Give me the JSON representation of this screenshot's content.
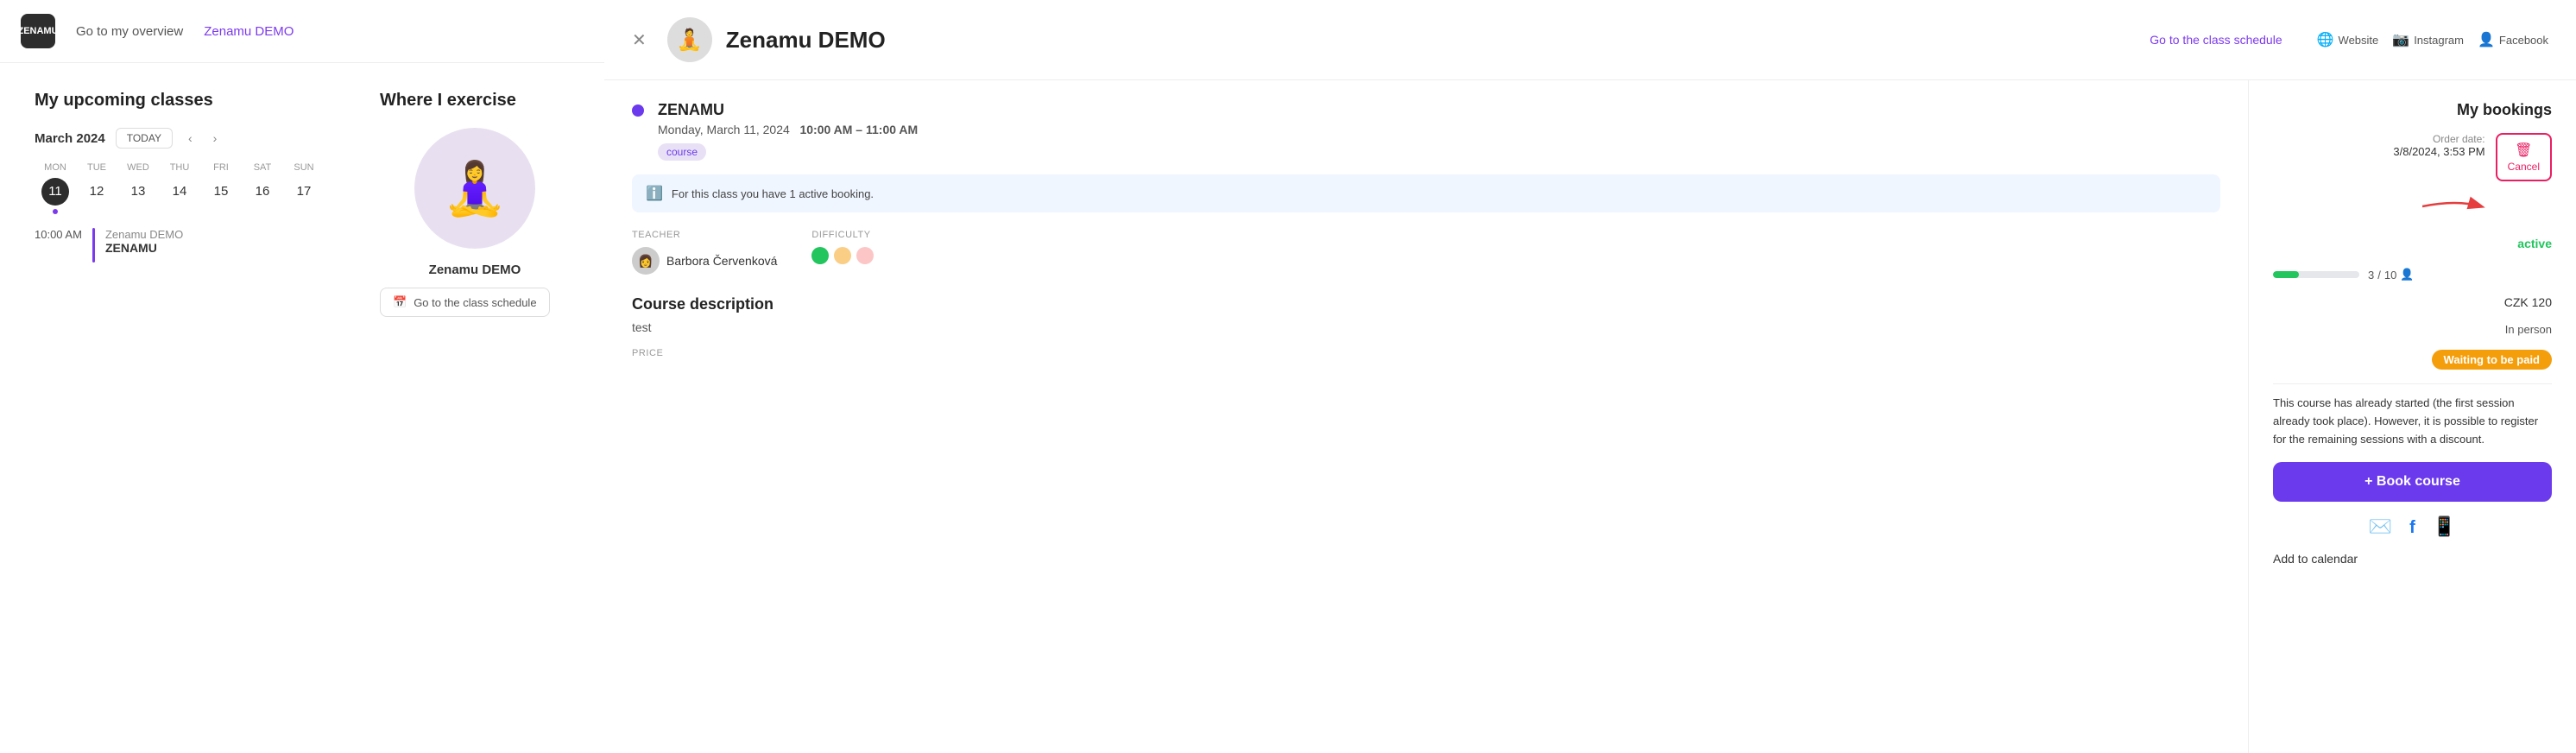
{
  "nav": {
    "logo_text": "ZENAMU",
    "go_to_overview": "Go to my overview",
    "studio_name": "Zenamu DEMO"
  },
  "left_panel": {
    "upcoming_title": "My upcoming classes",
    "month": "March 2024",
    "today_btn": "TODAY",
    "days": [
      {
        "name": "MON",
        "num": "11",
        "today": true
      },
      {
        "name": "TUE",
        "num": "12"
      },
      {
        "name": "WED",
        "num": "13"
      },
      {
        "name": "THU",
        "num": "14"
      },
      {
        "name": "FRI",
        "num": "15"
      },
      {
        "name": "SAT",
        "num": "16"
      },
      {
        "name": "SUN",
        "num": "17"
      }
    ],
    "event_time": "10:00 AM",
    "event_studio": "Zenamu DEMO",
    "event_class": "ZENAMU",
    "where_title": "Where I exercise",
    "studio_image_emoji": "🧘",
    "studio_title": "Zenamu DEMO",
    "schedule_btn": "Go to the class schedule",
    "calendar_icon": "📅"
  },
  "modal": {
    "close_icon": "✕",
    "studio_logo": "🧘",
    "studio_name": "Zenamu DEMO",
    "schedule_link": "Go to the class schedule",
    "social": [
      {
        "icon": "🌐",
        "label": "Website"
      },
      {
        "icon": "📷",
        "label": "Instagram"
      },
      {
        "icon": "👤",
        "label": "Facebook"
      }
    ],
    "class_name": "ZENAMU",
    "class_date": "Monday, March 11, 2024",
    "class_time": "10:00 AM – 11:00 AM",
    "class_tag": "course",
    "info_banner": "For this class you have 1 active booking.",
    "teacher_label": "TEACHER",
    "teacher_name": "Barbora Červenková",
    "difficulty_label": "DIFFICULTY",
    "course_desc_title": "Course description",
    "course_desc_text": "test",
    "price_label": "PRICE",
    "capacity_current": "3",
    "capacity_max": "10"
  },
  "sidebar": {
    "title": "My bookings",
    "order_label": "Order date:",
    "order_date": "3/8/2024, 3:53 PM",
    "cancel_label": "Cancel",
    "arrow": "→",
    "status": "active",
    "price": "CZK 120",
    "in_person": "In person",
    "waiting_badge": "Waiting to be paid",
    "promo_text": "This course has already started (the first session already took place). However, it is possible to register for the remaining sessions with a discount.",
    "book_btn": "+ Book course",
    "email_icon": "✉",
    "facebook_icon": "f",
    "whatsapp_icon": "📱",
    "add_calendar": "Add to calendar"
  }
}
